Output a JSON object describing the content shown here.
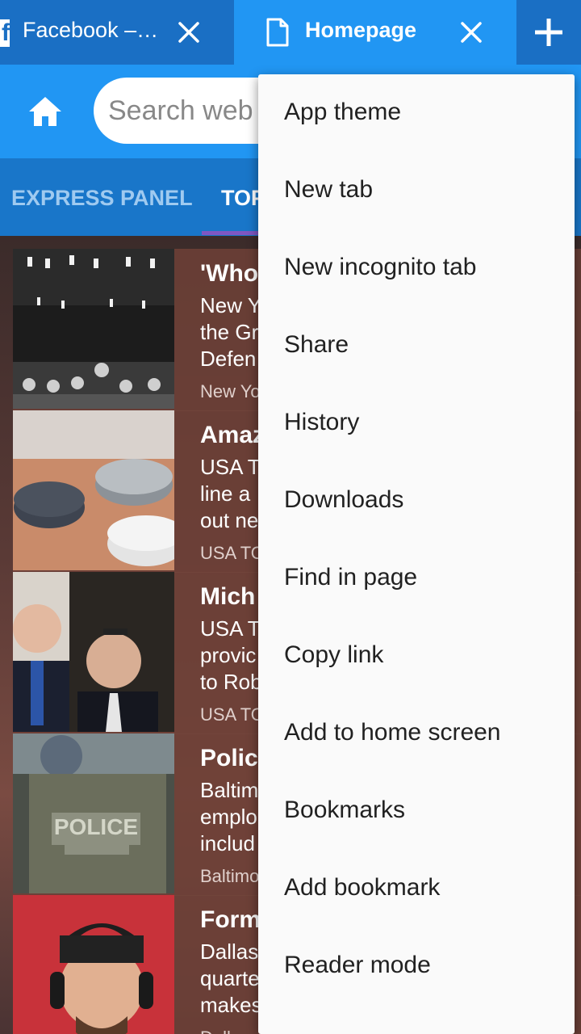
{
  "tabs": [
    {
      "title": "Facebook –…",
      "icon": "facebook-icon"
    },
    {
      "title": "Homepage",
      "icon": "document-icon"
    }
  ],
  "search": {
    "placeholder": "Search web"
  },
  "categories": [
    "EXPRESS PANEL",
    "TOP"
  ],
  "news": [
    {
      "headline": "'Who",
      "summary": "New Y\nthe Gr\nDefen",
      "source": "New Yo"
    },
    {
      "headline": "Amaz",
      "summary": "USA T\nline a\nout ne",
      "source": "USA TO"
    },
    {
      "headline": "Mich",
      "summary": "USA T\nprovic\nto Rob",
      "source": "USA TO"
    },
    {
      "headline": "Polic",
      "summary": "Baltim\nemplo\ninclud",
      "source": "Baltimo"
    },
    {
      "headline": "Form",
      "summary": "Dallas\nquarte\nmakes",
      "source": "Dalla"
    }
  ],
  "menu": {
    "items": [
      "App theme",
      "New tab",
      "New incognito tab",
      "Share",
      "History",
      "Downloads",
      "Find in page",
      "Copy link",
      "Add to home screen",
      "Bookmarks",
      "Add bookmark",
      "Reader mode"
    ]
  },
  "colors": {
    "tabbar": "#1e88e5",
    "active_tab": "#2196f3",
    "category_bar": "#1976c9",
    "menu_bg": "#fafafa"
  }
}
